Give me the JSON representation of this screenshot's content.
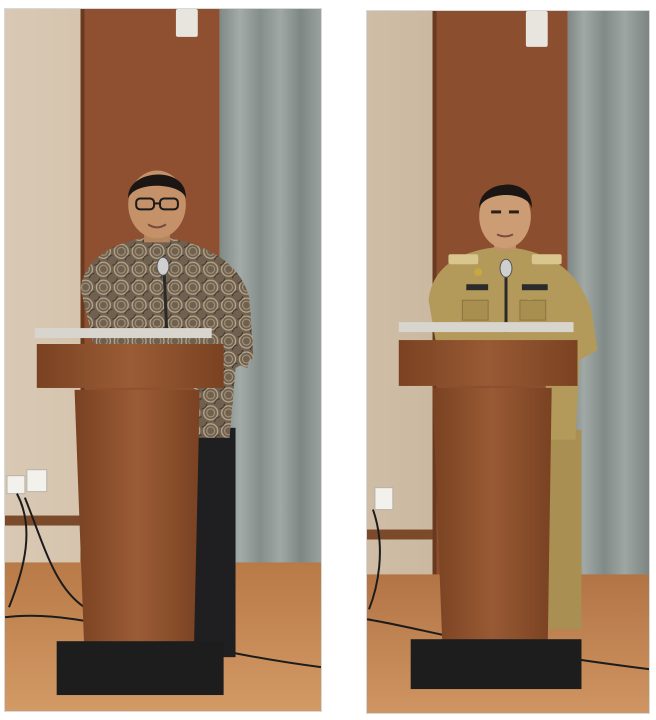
{
  "figure": {
    "panels": [
      {
        "id": "left",
        "subject": "speaker-in-batik-shirt-at-podium",
        "colors": {
          "wall": "#d8c7b2",
          "wood": "#8a4f2c",
          "curtain": "#8e9794",
          "floor": "#c88a56",
          "shirt": "#7d6d5a",
          "trousers": "#1f1f22"
        }
      },
      {
        "id": "right",
        "subject": "speaker-in-khaki-uniform-at-podium",
        "colors": {
          "wall": "#cdbba4",
          "wood": "#874c2b",
          "curtain": "#8b928f",
          "floor": "#c2854f",
          "uniform": "#b39a5a"
        }
      }
    ]
  }
}
